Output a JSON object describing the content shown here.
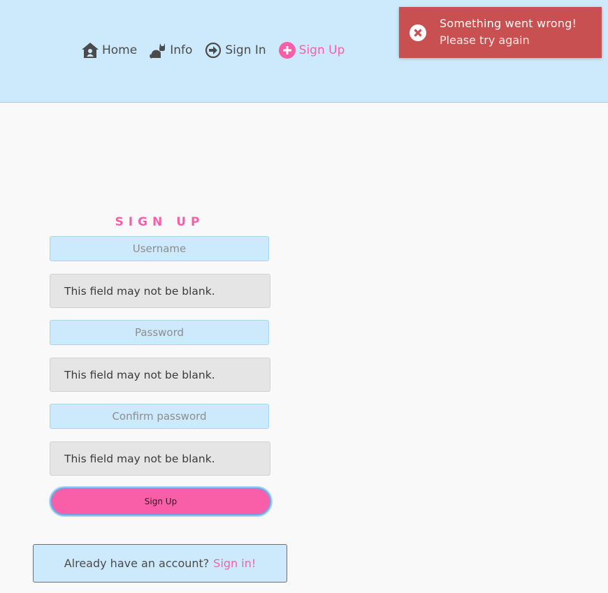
{
  "nav": {
    "items": [
      {
        "label": "Home",
        "icon": "home-user-icon"
      },
      {
        "label": "Info",
        "icon": "cat-icon"
      },
      {
        "label": "Sign In",
        "icon": "arrow-circle-right-icon"
      },
      {
        "label": "Sign Up",
        "icon": "plus-circle-icon",
        "active": true
      }
    ]
  },
  "toast": {
    "title": "Something went wrong!",
    "message": "Please try again",
    "icon": "close-circle-icon"
  },
  "form": {
    "title": "SIGN UP",
    "username_placeholder": "Username",
    "password_placeholder": "Password",
    "confirm_placeholder": "Confirm password",
    "errors": {
      "username": "This field may not be blank.",
      "password": "This field may not be blank.",
      "confirm": "This field may not be blank."
    },
    "submit_label": "Sign Up"
  },
  "signin": {
    "text": "Already have an account?",
    "link": "Sign in!"
  },
  "colors": {
    "navbar_bg": "#cdeafc",
    "accent_pink": "#f95fa8",
    "toast_red": "#c95050",
    "error_bg": "#e5e5e5"
  }
}
